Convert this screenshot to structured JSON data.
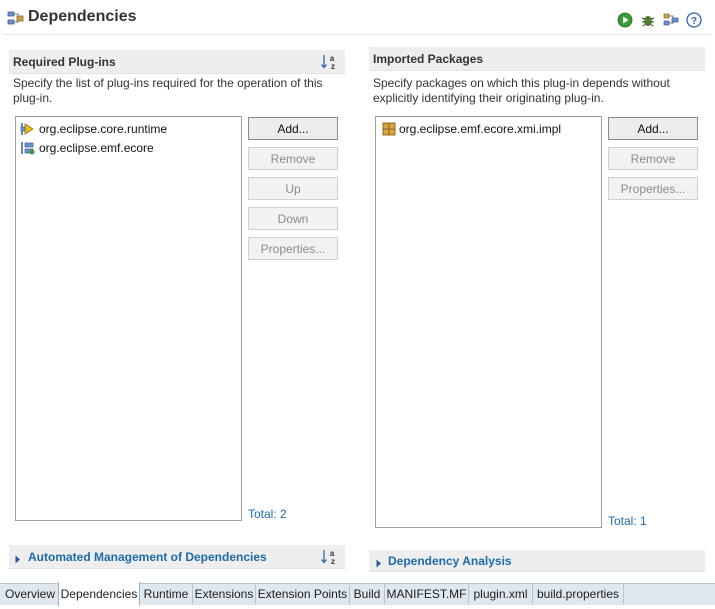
{
  "header": {
    "title": "Dependencies",
    "tools": [
      "run-icon",
      "debug-icon",
      "export-icon",
      "help-icon"
    ]
  },
  "required_plugins": {
    "title": "Required Plug-ins",
    "description": "Specify the list of plug-ins required for the operation of this plug-in.",
    "items": [
      "org.eclipse.core.runtime",
      "org.eclipse.emf.ecore"
    ],
    "buttons": {
      "add": "Add...",
      "remove": "Remove",
      "up": "Up",
      "down": "Down",
      "properties": "Properties..."
    },
    "total": "Total: 2"
  },
  "imported_packages": {
    "title": "Imported Packages",
    "description": "Specify packages on which this plug-in depends without explicitly identifying their originating plug-in.",
    "items": [
      "org.eclipse.emf.ecore.xmi.impl"
    ],
    "buttons": {
      "add": "Add...",
      "remove": "Remove",
      "properties": "Properties..."
    },
    "total": "Total: 1"
  },
  "automated_management": {
    "title": "Automated Management of Dependencies"
  },
  "dependency_analysis": {
    "title": "Dependency Analysis"
  },
  "tabs": [
    "Overview",
    "Dependencies",
    "Runtime",
    "Extensions",
    "Extension Points",
    "Build",
    "MANIFEST.MF",
    "plugin.xml",
    "build.properties"
  ],
  "active_tab": "Dependencies",
  "colors": {
    "link": "#1f6aa8",
    "section_bg": "#eeeeee",
    "tab_bar": "#dfe7ef"
  }
}
